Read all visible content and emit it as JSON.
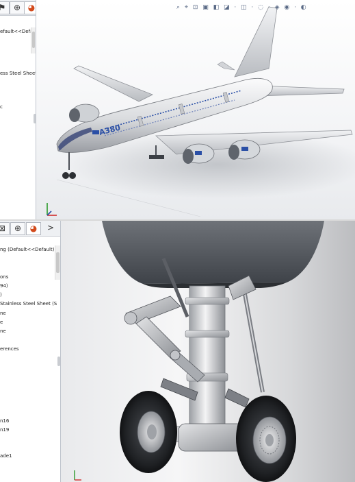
{
  "top": {
    "tree_items": [
      "efault<<Default",
      "ess Steel Sheet (",
      "c"
    ]
  },
  "bottom": {
    "tab_more": ">",
    "tree_items": [
      "ng  (Default<<Default)",
      "ons",
      "94)",
      ")",
      " Stainless Steel Sheet (S",
      "ne",
      "e",
      "ne",
      "erences",
      "n16",
      "n19",
      "ade1"
    ]
  },
  "icons": [
    "flag-icon",
    "feature-tree-icon",
    "config-manager-icon",
    "appearance-icon",
    "view-heads-up-toolbar",
    "triad-icon"
  ],
  "model": {
    "aircraft_label": "A380",
    "accent": "#2a4fa6"
  }
}
